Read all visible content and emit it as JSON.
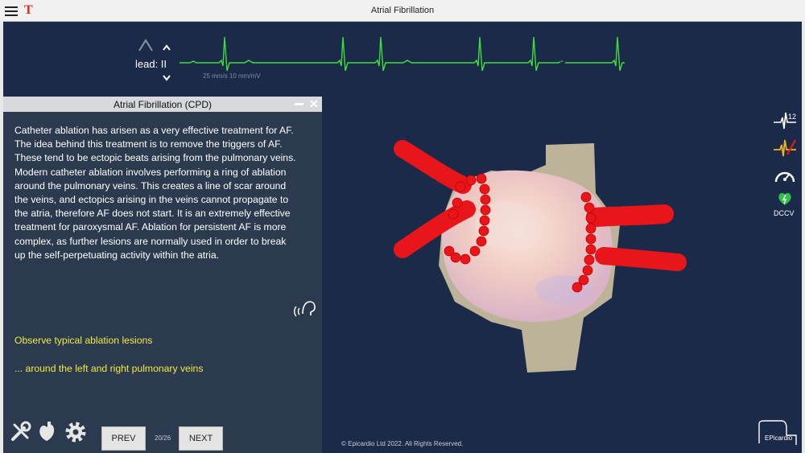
{
  "window": {
    "title": "Atrial Fibrillation"
  },
  "ecg": {
    "lead_label": "lead: II",
    "speed_label": "25 mm/s  10 mm/mV"
  },
  "panel": {
    "title": "Atrial Fibrillation (CPD)",
    "body_lines": [
      "Catheter ablation has arisen as a very effective treatment for AF.",
      "The idea behind this treatment is to remove the triggers of AF.",
      "These tend to be ectopic beats arising from the pulmonary veins.",
      "Modern catheter ablation involves performing a ring of ablation",
      "around the pulmonary veins.  This creates a line of scar around",
      "the veins, and ectopics arising in the veins cannot propagate to",
      "the atria, therefore AF does not start.  It is an extremely effective",
      "treatment for paroxysmal AF.  Ablation for persistent AF is more",
      "complex, as further lesions are normally used in order to break",
      "up the self-perpetuating activity within the atria."
    ],
    "observe_1": "Observe typical ablation lesions",
    "observe_2": "... around the left and right pulmonary veins"
  },
  "nav": {
    "prev_label": "PREV",
    "next_label": "NEXT",
    "page": "20/26"
  },
  "right_toolbar": {
    "dccv_label": "DCCV"
  },
  "footer": {
    "copyright": "© Epicardio Ltd 2022. All Rights Reserved.",
    "logo_text": "EPicardio"
  },
  "colors": {
    "background": "#1b2a48",
    "panel": "#2b3a4e",
    "ecg_trace": "#3be03b",
    "lesion_red": "#e8151a",
    "highlight_yellow": "#f2ea3c"
  }
}
